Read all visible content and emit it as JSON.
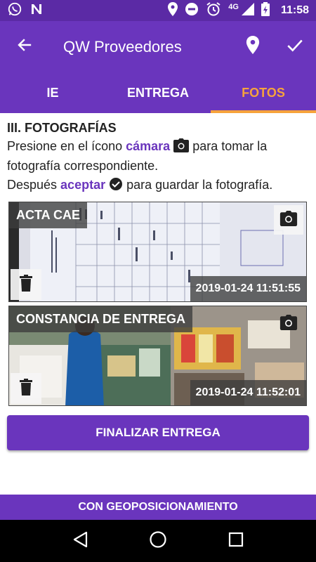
{
  "status_bar": {
    "network": "4G",
    "time": "11:58",
    "icons": [
      "whatsapp-icon",
      "n-notification-icon",
      "location-icon",
      "do-not-disturb-icon",
      "alarm-icon",
      "signal-icon",
      "battery-charging-icon"
    ]
  },
  "app_bar": {
    "title": "QW Proveedores",
    "back_icon": "arrow-back-icon",
    "actions": [
      "location-pin-icon",
      "check-icon"
    ]
  },
  "tabs": [
    {
      "label": "IE",
      "active": false
    },
    {
      "label": "ENTREGA",
      "active": false
    },
    {
      "label": "FOTOS",
      "active": true
    }
  ],
  "section": {
    "title": "III. FOTOGRAFÍAS",
    "line1_pre": "Presione en el ícono ",
    "line1_kw": "cámara",
    "line1_post": " para tomar la fotografía correspondiente.",
    "line2_pre": "Después ",
    "line2_kw": "aceptar",
    "line2_post": " para guardar la fotografía."
  },
  "photos": [
    {
      "label": "ACTA CAE",
      "timestamp": "2019-01-24 11:51:55"
    },
    {
      "label": "CONSTANCIA DE ENTREGA",
      "timestamp": "2019-01-24 11:52:01"
    }
  ],
  "buttons": {
    "finalizar": "FINALIZAR ENTREGA",
    "geo": "CON GEOPOSICIONAMIENTO"
  },
  "colors": {
    "primary": "#6a35bd",
    "status_bar": "#5b2aa5",
    "tab_active": "#f6a33c"
  }
}
